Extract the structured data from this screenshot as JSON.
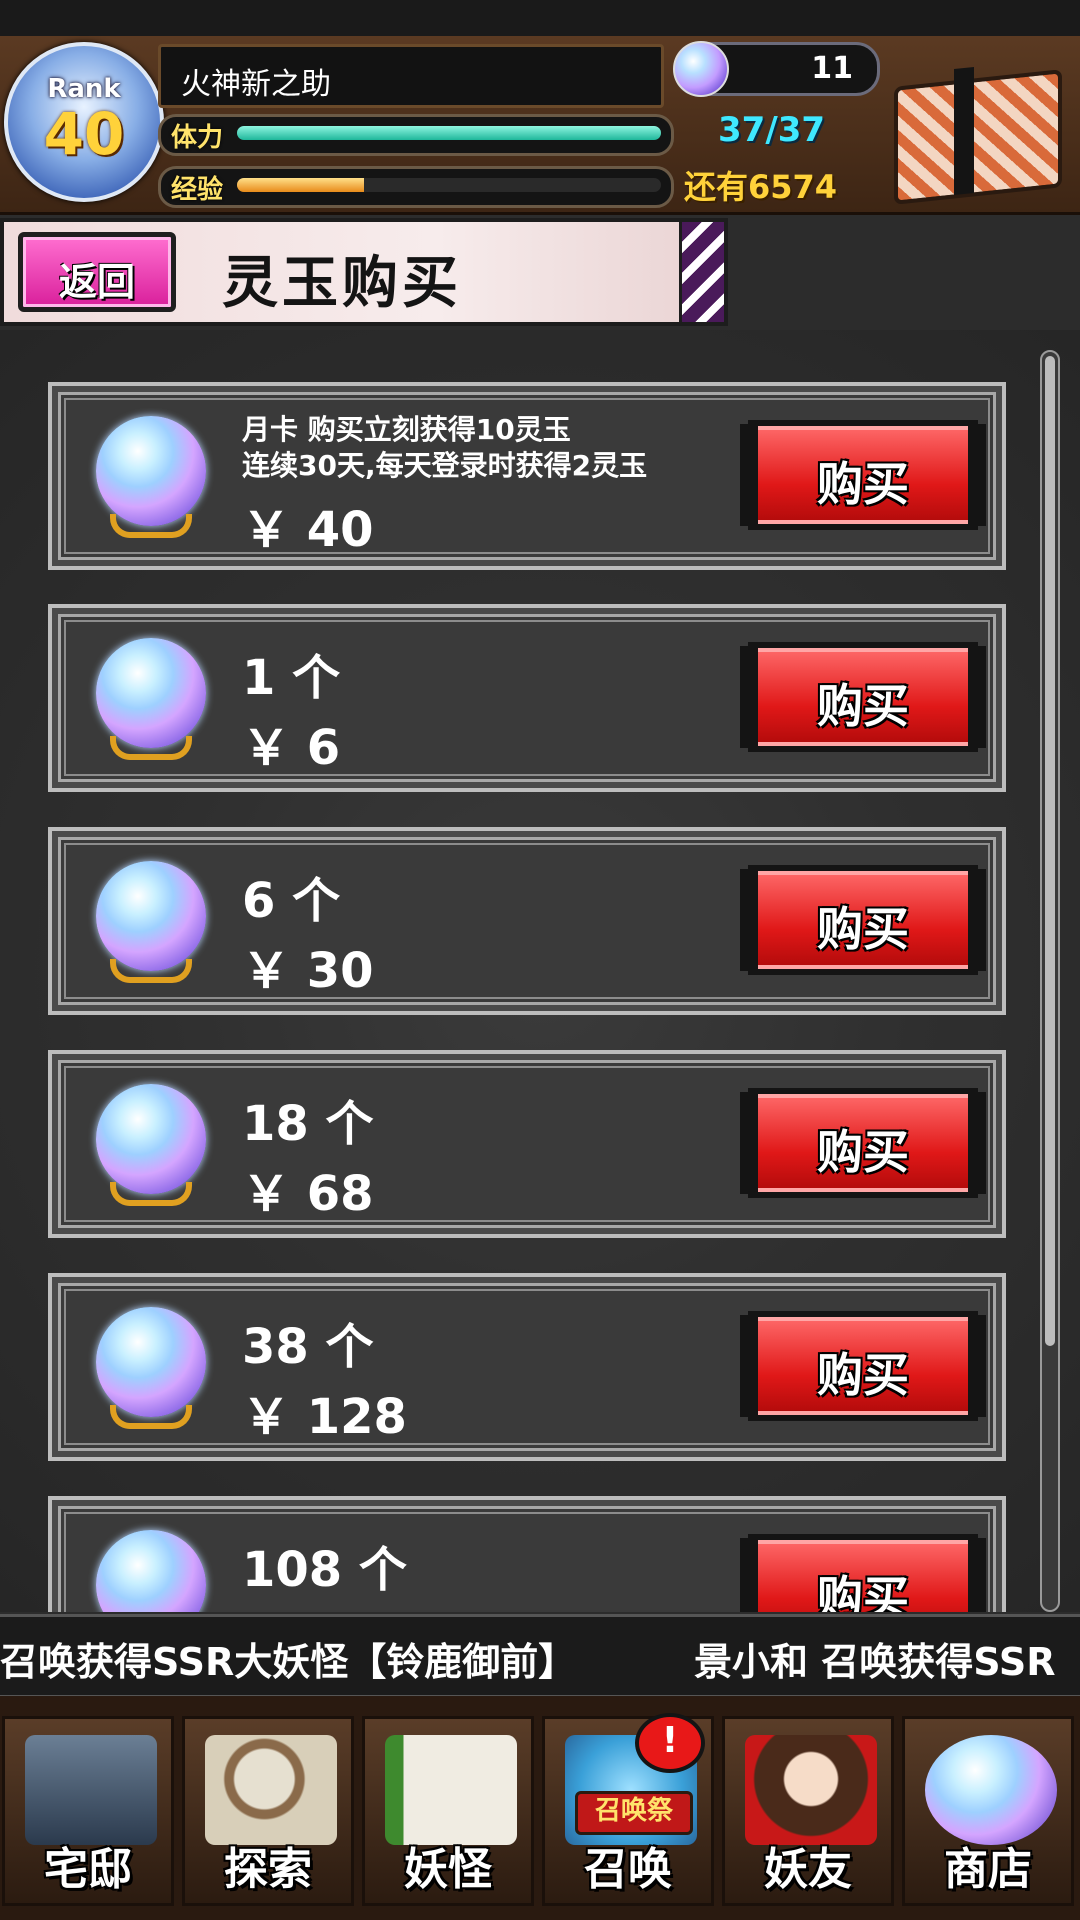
{
  "header": {
    "rank_label": "Rank",
    "rank_value": "40",
    "player_name": "火神新之助",
    "stamina_label": "体力",
    "stamina_value": "37/37",
    "stamina_fill": 1.0,
    "exp_label": "经验",
    "exp_fill": 0.3,
    "exp_remaining": "还有6574",
    "gem_count": "11",
    "gem_icon": "spirit-jade-icon",
    "chest_icon": "treasure-chest-icon"
  },
  "title_bar": {
    "back_label": "返回",
    "title": "灵玉购买"
  },
  "items": [
    {
      "desc_line1": "月卡 购买立刻获得10灵玉",
      "desc_line2": "连续30天,每天登录时获得2灵玉",
      "price": "￥ 40",
      "buy_label": "购买"
    },
    {
      "qty": "1 个",
      "price": "￥ 6",
      "buy_label": "购买"
    },
    {
      "qty": "6 个",
      "price": "￥ 30",
      "buy_label": "购买"
    },
    {
      "qty": "18 个",
      "price": "￥ 68",
      "buy_label": "购买"
    },
    {
      "qty": "38 个",
      "price": "￥ 128",
      "buy_label": "购买"
    },
    {
      "qty": "108 个",
      "price": "",
      "buy_label": "购买"
    }
  ],
  "ticker": {
    "message1": "召唤获得SSR大妖怪【铃鹿御前】",
    "message2": "景小和 召唤获得SSR"
  },
  "nav": {
    "items": [
      {
        "label": "宅邸",
        "icon": "mansion-icon"
      },
      {
        "label": "探索",
        "icon": "magnifier-map-icon"
      },
      {
        "label": "妖怪",
        "icon": "yokai-scroll-icon"
      },
      {
        "label": "召唤",
        "icon": "summon-star-icon",
        "badge": "!",
        "ribbon": "召唤祭"
      },
      {
        "label": "妖友",
        "icon": "fox-girl-icon"
      },
      {
        "label": "商店",
        "icon": "spirit-jade-icon"
      }
    ]
  },
  "colors": {
    "stamina": "#1fb79b",
    "exp": "#e88b1a",
    "buy_button": "#e01818",
    "back_button": "#d91f9b"
  }
}
